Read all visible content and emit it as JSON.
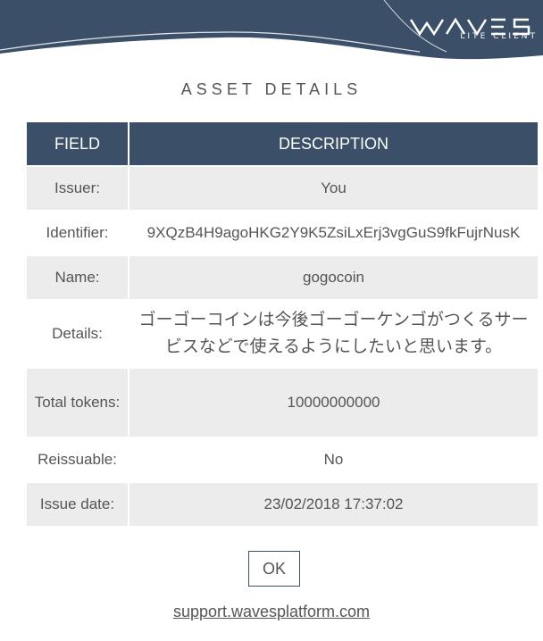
{
  "header": {
    "logo_text": "WAVES",
    "logo_subtitle": "LITE CLIENT"
  },
  "dialog": {
    "title": "ASSET DETAILS",
    "table": {
      "headers": [
        "FIELD",
        "DESCRIPTION"
      ],
      "rows": [
        {
          "field": "Issuer:",
          "value": "You"
        },
        {
          "field": "Identifier:",
          "value": "9XQzB4H9agoHKG2Y9K5ZsiLxErj3vgGuS9fkFujrNusK"
        },
        {
          "field": "Name:",
          "value": "gogocoin"
        },
        {
          "field": "Details:",
          "value": "ゴーゴーコインは今後ゴーゴーケンゴがつくるサービスなどで使えるようにしたいと思います。"
        },
        {
          "field": "Total tokens:",
          "value": "10000000000"
        },
        {
          "field": "Reissuable:",
          "value": "No"
        },
        {
          "field": "Issue date:",
          "value": "23/02/2018 17:37:02"
        }
      ]
    },
    "ok_label": "OK",
    "support_link": "support.wavesplatform.com"
  },
  "colors": {
    "header_bg": "#3b5068",
    "row_shade": "#ececec",
    "text": "#555555"
  }
}
